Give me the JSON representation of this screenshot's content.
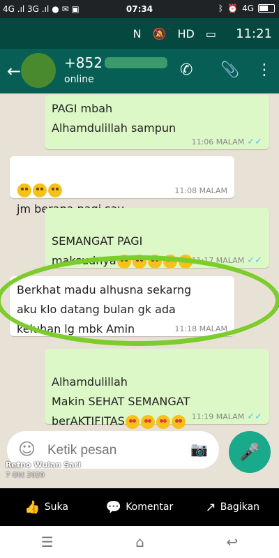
{
  "outer_status": {
    "left": "4G .ıl 3G .ıl",
    "time": "07:34",
    "right": "4G"
  },
  "inner_status": {
    "time": "11:21",
    "icons": [
      "nfc-icon",
      "mute-icon",
      "hd-signal-icon",
      "card-icon"
    ]
  },
  "header": {
    "contact_number": "+852",
    "status": "online"
  },
  "messages": [
    {
      "text": "PAGI mbah\nAlhamdulillah sampun",
      "time": "11:06 MALAM",
      "direction": "out",
      "emoji": 0
    },
    {
      "text": "jm berapa pagi say",
      "time": "11:08 MALAM",
      "direction": "in",
      "emoji": 3
    },
    {
      "text": "SEMANGAT PAGI\nmaksudnya",
      "time": "11:17 MALAM",
      "direction": "out",
      "emoji": 5
    },
    {
      "text": "Berkhat madu alhusna sekarng\naku klo datang bulan gk ada\nkeluhan lg mbk Amin",
      "time": "11:18 MALAM",
      "direction": "in",
      "emoji": 0
    },
    {
      "text": "Alhamdulillah\nMakin SEHAT SEMANGAT\nberAKTIFITAS",
      "time": "11:19 MALAM",
      "direction": "out",
      "emoji": 4
    }
  ],
  "input": {
    "placeholder": "Ketik pesan"
  },
  "facebook": {
    "owner": "Retno Wulan Sari",
    "date": "7 Okt 2020",
    "actions": [
      {
        "label": "Suka",
        "icon": "like-icon"
      },
      {
        "label": "Komentar",
        "icon": "comment-icon"
      },
      {
        "label": "Bagikan",
        "icon": "share-icon"
      }
    ]
  },
  "colors": {
    "header": "#075e54",
    "outgoing": "#dcf8c6",
    "incoming": "#ffffff",
    "circle": "#7ccc2b",
    "mic": "#19a98b"
  }
}
